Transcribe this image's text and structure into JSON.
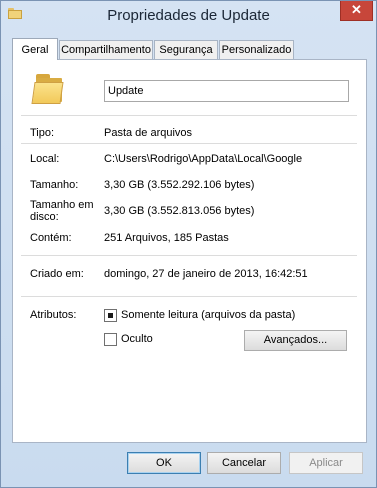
{
  "window": {
    "title": "Propriedades de Update",
    "close_glyph": "✕"
  },
  "tabs": [
    {
      "label": "Geral"
    },
    {
      "label": "Compartilhamento"
    },
    {
      "label": "Segurança"
    },
    {
      "label": "Personalizado"
    }
  ],
  "general": {
    "name_value": "Update",
    "rows": {
      "type": {
        "label": "Tipo:",
        "value": "Pasta de arquivos"
      },
      "location": {
        "label": "Local:",
        "value": "C:\\Users\\Rodrigo\\AppData\\Local\\Google"
      },
      "size": {
        "label": "Tamanho:",
        "value": "3,30 GB (3.552.292.106 bytes)"
      },
      "size_on_disk": {
        "label_line1": "Tamanho em",
        "label_line2": "disco:",
        "value": "3,30 GB (3.552.813.056 bytes)"
      },
      "contains": {
        "label": "Contém:",
        "value": "251 Arquivos, 185 Pastas"
      },
      "created": {
        "label": "Criado em:",
        "value": "domingo, 27 de janeiro de 2013, 16:42:51"
      }
    },
    "attributes": {
      "label": "Atributos:",
      "read_only": {
        "label": "Somente leitura (arquivos da pasta)",
        "state": "indeterminate"
      },
      "hidden": {
        "label": "Oculto",
        "checked": false
      },
      "advanced_button": "Avançados..."
    }
  },
  "buttons": {
    "ok": "OK",
    "cancel": "Cancelar",
    "apply": "Aplicar"
  },
  "icons": {
    "title_icon": "folder-icon",
    "close": "close-icon",
    "content_icon": "folder-icon"
  },
  "colors": {
    "close_button": "#c7463a",
    "window_frame": "#c9dbef"
  }
}
